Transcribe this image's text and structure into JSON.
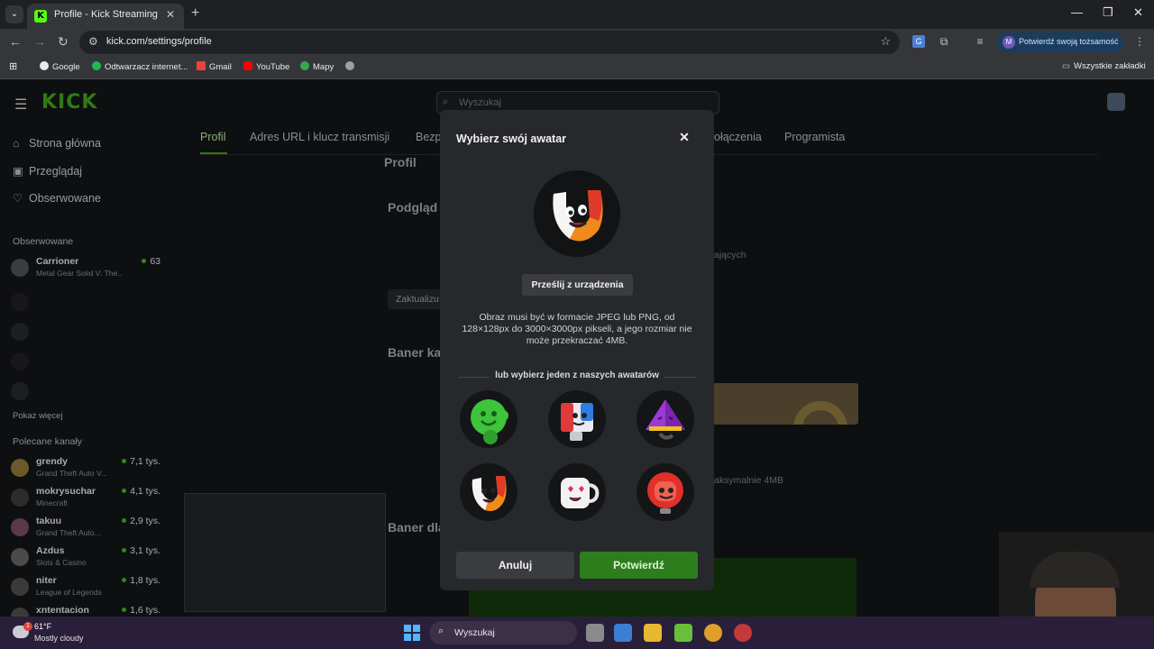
{
  "browser": {
    "tab_title": "Profile - Kick Streaming",
    "url": "kick.com/settings/profile",
    "verify_label": "Potwierdź swoją tożsamość",
    "verify_avatar": "M",
    "bookmarks": [
      "Google",
      "Odtwarzacz internet...",
      "Gmail",
      "YouTube",
      "Mapy"
    ],
    "all_bookmarks": "Wszystkie zakładki"
  },
  "site": {
    "logo": "KICK",
    "search_placeholder": "Wyszukaj",
    "nav": [
      "Strona główna",
      "Przeglądaj",
      "Obserwowane"
    ],
    "following_header": "Obserwowane",
    "followed": [
      {
        "name": "Carrioner",
        "game": "Metal Gear Solid V: The...",
        "viewers": "63"
      }
    ],
    "show_more": "Pokaż więcej",
    "recommended_header": "Polecane kanały",
    "recommended": [
      {
        "name": "grendy",
        "game": "Grand Theft Auto V...",
        "viewers": "7,1 tys."
      },
      {
        "name": "mokrysuchar",
        "game": "Minecraft",
        "viewers": "4,1 tys."
      },
      {
        "name": "takuu",
        "game": "Grand Theft Auto...",
        "viewers": "2,9 tys."
      },
      {
        "name": "Azdus",
        "game": "Slots & Casino",
        "viewers": "3,1 tys."
      },
      {
        "name": "niter",
        "game": "League of Legends",
        "viewers": "1,8 tys."
      },
      {
        "name": "xntentacion",
        "game": "",
        "viewers": "1,6 tys."
      }
    ],
    "settings_tabs": [
      "Profil",
      "Adres URL i klucz transmisji",
      "Bezp",
      "ołączenia",
      "Programista"
    ],
    "section_profile": "Profil",
    "section_preview": "Podgląd p",
    "update_btn": "Zaktualizu",
    "followers_partial": "ających",
    "section_banner": "Baner ka",
    "banner_max": "aksymalnie 4MB",
    "section_banner2": "Baner dla"
  },
  "modal": {
    "title": "Wybierz swój awatar",
    "upload_btn": "Prześlij z urządzenia",
    "info": "Obraz musi być w formacie JPEG lub PNG, od 128×128px do 3000×3000px pikseli, a jego rozmiar nie może przekraczać 4MB.",
    "divider": "lub wybierz jeden z naszych awatarów",
    "cancel": "Anuluj",
    "confirm": "Potwierdź",
    "avatars": [
      "green-blob-avatar",
      "blue-red-cube-avatar",
      "purple-pyramid-avatar",
      "orange-u-avatar",
      "mug-hearts-avatar",
      "red-helmet-avatar"
    ]
  },
  "taskbar": {
    "temp": "61°F",
    "condition": "Mostly cloudy",
    "weather_badge": "1",
    "search": "Wyszukaj"
  }
}
